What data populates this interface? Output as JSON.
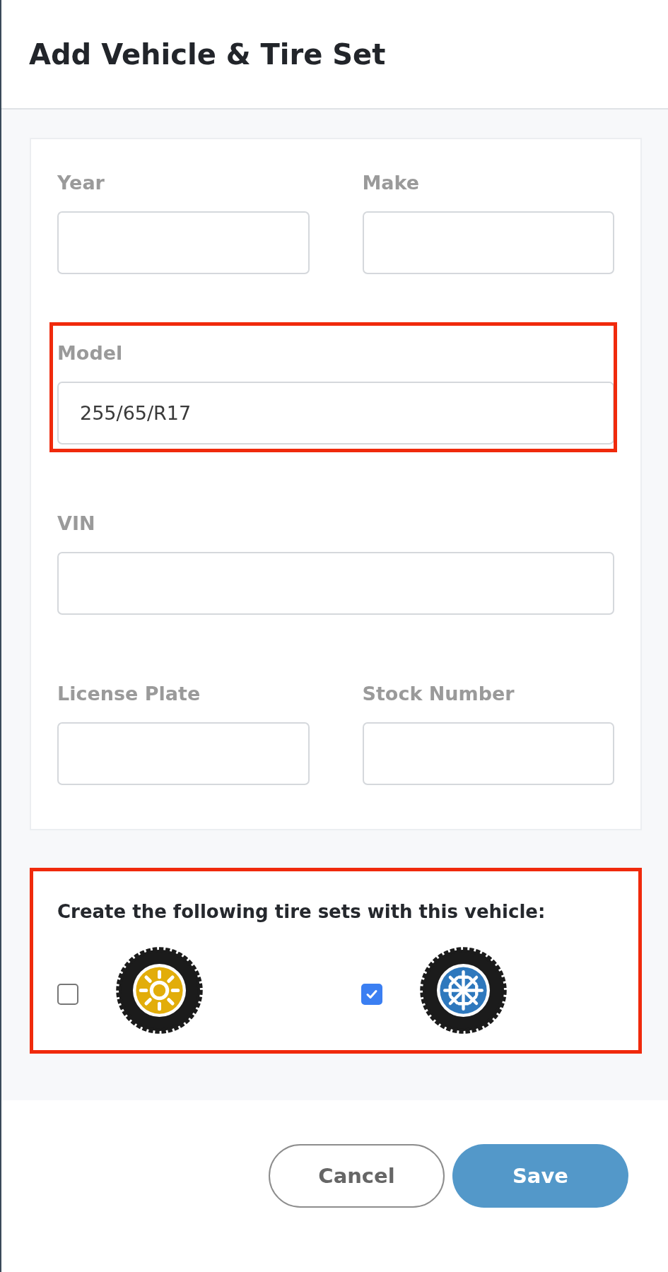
{
  "dialog": {
    "title": "Add Vehicle & Tire Set"
  },
  "rows": [
    {
      "highlighted": false,
      "fields": [
        {
          "label": "Year"
        },
        {
          "label": "Make"
        }
      ]
    },
    {
      "highlighted": true,
      "fields": [
        {
          "label": "Model",
          "value": "255/65/R17"
        }
      ]
    },
    {
      "highlighted": false,
      "fields": [
        {
          "label": "VIN"
        }
      ]
    },
    {
      "highlighted": false,
      "fields": [
        {
          "label": "License Plate"
        },
        {
          "label": "Stock Number"
        }
      ]
    }
  ],
  "tire_sets": {
    "heading": "Create the following tire sets with this vehicle:",
    "highlighted": true,
    "options": [
      {
        "kind": "summer",
        "checked": false
      },
      {
        "kind": "winter",
        "checked": true
      }
    ]
  },
  "buttons": [
    {
      "label": "Cancel",
      "kind": "secondary"
    },
    {
      "label": "Save",
      "kind": "primary"
    }
  ]
}
